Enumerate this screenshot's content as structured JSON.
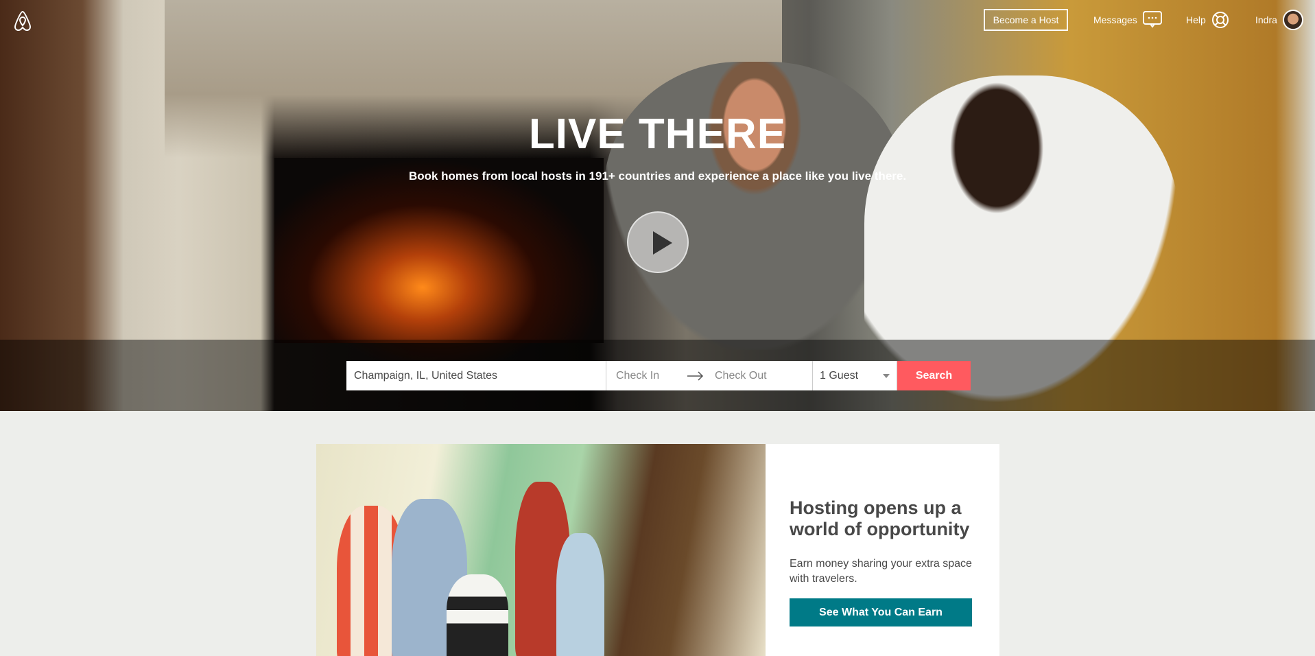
{
  "header": {
    "become_host": "Become a Host",
    "messages": "Messages",
    "help": "Help",
    "user": "Indra"
  },
  "hero": {
    "title": "LIVE THERE",
    "subtitle": "Book homes from local hosts in 191+ countries and experience a place like you live there."
  },
  "search": {
    "location": "Champaign, IL, United States",
    "check_in_placeholder": "Check In",
    "check_out_placeholder": "Check Out",
    "guests": "1 Guest",
    "button": "Search"
  },
  "hosting": {
    "heading": "Hosting opens up a world of opportunity",
    "body": "Earn money sharing your extra space with travelers.",
    "button": "See What You Can Earn"
  },
  "colors": {
    "brand": "#ff5a5f",
    "teal": "#007a87"
  }
}
